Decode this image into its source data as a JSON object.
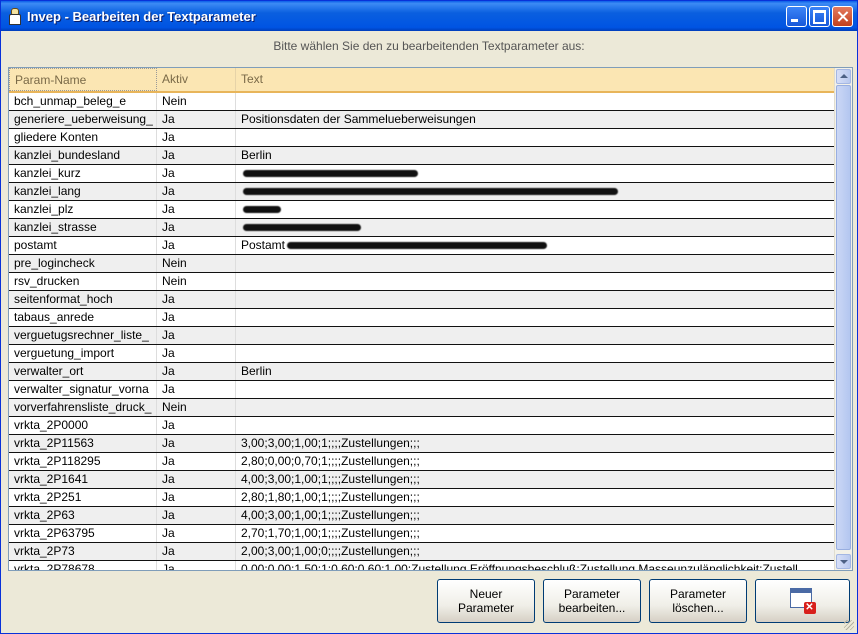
{
  "window": {
    "title": "Invep - Bearbeiten der Textparameter"
  },
  "instruction": "Bitte wählen Sie den zu bearbeitenden Textparameter aus:",
  "table": {
    "headers": [
      "Param-Name",
      "Aktiv",
      "Text"
    ],
    "rows": [
      {
        "name": "bch_unmap_beleg_e",
        "aktiv": "Nein",
        "text": ""
      },
      {
        "name": "generiere_ueberweisung_",
        "aktiv": "Ja",
        "text": "Positionsdaten der Sammelueberweisungen"
      },
      {
        "name": "gliedere Konten",
        "aktiv": "Ja",
        "text": ""
      },
      {
        "name": "kanzlei_bundesland",
        "aktiv": "Ja",
        "text": "Berlin"
      },
      {
        "name": "kanzlei_kurz",
        "aktiv": "Ja",
        "text": ""
      },
      {
        "name": "kanzlei_lang",
        "aktiv": "Ja",
        "text": ""
      },
      {
        "name": "kanzlei_plz",
        "aktiv": "Ja",
        "text": ""
      },
      {
        "name": "kanzlei_strasse",
        "aktiv": "Ja",
        "text": ""
      },
      {
        "name": "postamt",
        "aktiv": "Ja",
        "text": "Postamt"
      },
      {
        "name": "pre_logincheck",
        "aktiv": "Nein",
        "text": ""
      },
      {
        "name": "rsv_drucken",
        "aktiv": "Nein",
        "text": ""
      },
      {
        "name": "seitenformat_hoch",
        "aktiv": "Ja",
        "text": ""
      },
      {
        "name": "tabaus_anrede",
        "aktiv": "Ja",
        "text": ""
      },
      {
        "name": "verguetugsrechner_liste_",
        "aktiv": "Ja",
        "text": ""
      },
      {
        "name": "verguetung_import",
        "aktiv": "Ja",
        "text": ""
      },
      {
        "name": "verwalter_ort",
        "aktiv": "Ja",
        "text": "Berlin"
      },
      {
        "name": "verwalter_signatur_vorna",
        "aktiv": "Ja",
        "text": ""
      },
      {
        "name": "vorverfahrensliste_druck_",
        "aktiv": "Nein",
        "text": ""
      },
      {
        "name": "vrkta_2P0000",
        "aktiv": "Ja",
        "text": ""
      },
      {
        "name": "vrkta_2P11563",
        "aktiv": "Ja",
        "text": "3,00;3,00;1,00;1;;;;Zustellungen;;;"
      },
      {
        "name": "vrkta_2P118295",
        "aktiv": "Ja",
        "text": "2,80;0,00;0,70;1;;;;Zustellungen;;;"
      },
      {
        "name": "vrkta_2P1641",
        "aktiv": "Ja",
        "text": "4,00;3,00;1,00;1;;;;Zustellungen;;;"
      },
      {
        "name": "vrkta_2P251",
        "aktiv": "Ja",
        "text": "2,80;1,80;1,00;1;;;;Zustellungen;;;"
      },
      {
        "name": "vrkta_2P63",
        "aktiv": "Ja",
        "text": "4,00;3,00;1,00;1;;;;Zustellungen;;;"
      },
      {
        "name": "vrkta_2P63795",
        "aktiv": "Ja",
        "text": "2,70;1,70;1,00;1;;;;Zustellungen;;;"
      },
      {
        "name": "vrkta_2P73",
        "aktiv": "Ja",
        "text": "2,00;3,00;1,00;0;;;;Zustellungen;;;"
      },
      {
        "name": "vrkta_2P78678",
        "aktiv": "Ja",
        "text": "0,00;0,00;1,50;1;0,60;0,60;1,00;Zustellung Eröffnungsbeschluß;Zustellung Masseunzulänglichkeit;Zustell"
      }
    ]
  },
  "buttons": {
    "new_line1": "Neuer",
    "new_line2": "Parameter",
    "edit_line1": "Parameter",
    "edit_line2": "bearbeiten...",
    "delete_line1": "Parameter",
    "delete_line2": "löschen...",
    "exit_icon": "exit-window-icon"
  }
}
